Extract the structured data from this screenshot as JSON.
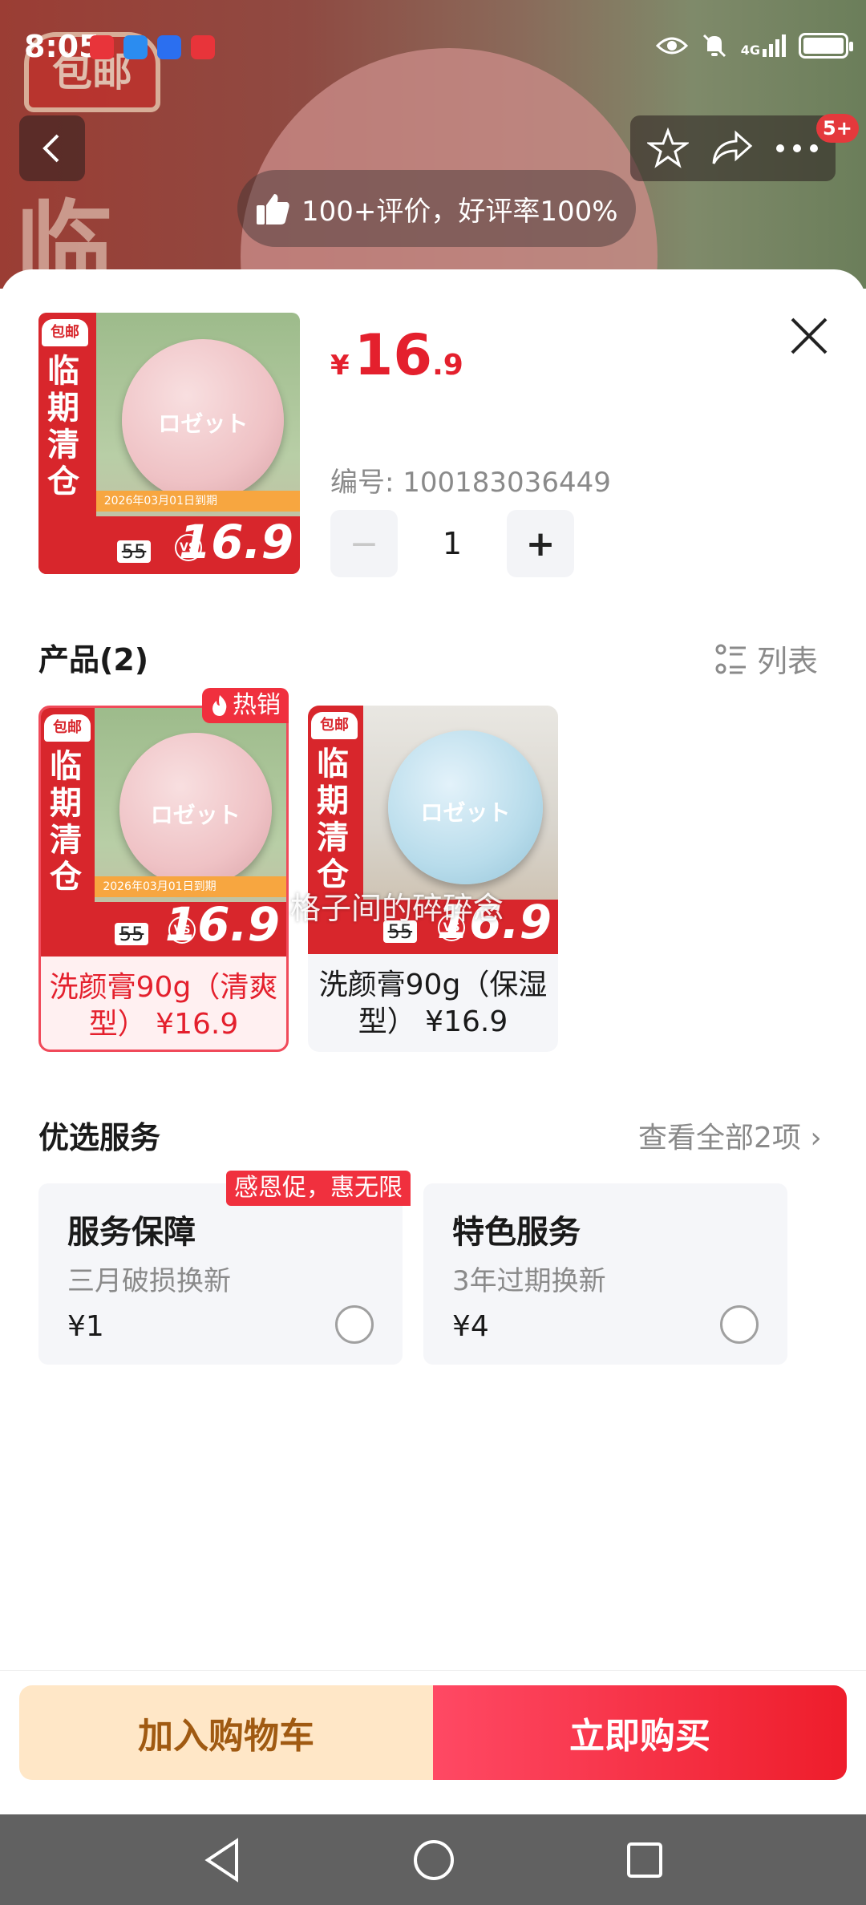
{
  "status": {
    "time": "8:05",
    "network": "4G"
  },
  "nav": {
    "badge": "5+"
  },
  "review": {
    "text": "100+评价，好评率100%"
  },
  "product": {
    "price_symbol": "¥",
    "price_int": "16",
    "price_dec": ".9",
    "sku_label": "编号: 100183036449",
    "quantity": "1",
    "minus": "−",
    "plus": "+"
  },
  "product_art": {
    "logo": "包邮",
    "vertical_words": "临期清仓",
    "brand": "ロゼット",
    "date": "2026年03月01日到期",
    "old_price": "55",
    "vs": "VS",
    "new_price": "16.9"
  },
  "products_section": {
    "title": "产品(2)",
    "list_toggle": "列表",
    "hot_tag": "热销",
    "items": [
      {
        "label": "洗颜膏90g（清爽型） ¥16.9",
        "selected": true
      },
      {
        "label": "洗颜膏90g（保湿型） ¥16.9",
        "selected": false
      }
    ]
  },
  "watermark": "格子间的碎碎念",
  "services_section": {
    "title": "优选服务",
    "see_all": "查看全部2项 ›",
    "promo_tag": "感恩促，惠无限",
    "items": [
      {
        "title": "服务保障",
        "subtitle": "三月破损换新",
        "price": "¥1"
      },
      {
        "title": "特色服务",
        "subtitle": "3年过期换新",
        "price": "¥4"
      }
    ]
  },
  "actions": {
    "add_to_cart": "加入购物车",
    "buy_now": "立即购买"
  },
  "colors": {
    "accent": "#e4202d",
    "cart_bg": "#ffe7c7",
    "cart_text": "#a05a12"
  }
}
